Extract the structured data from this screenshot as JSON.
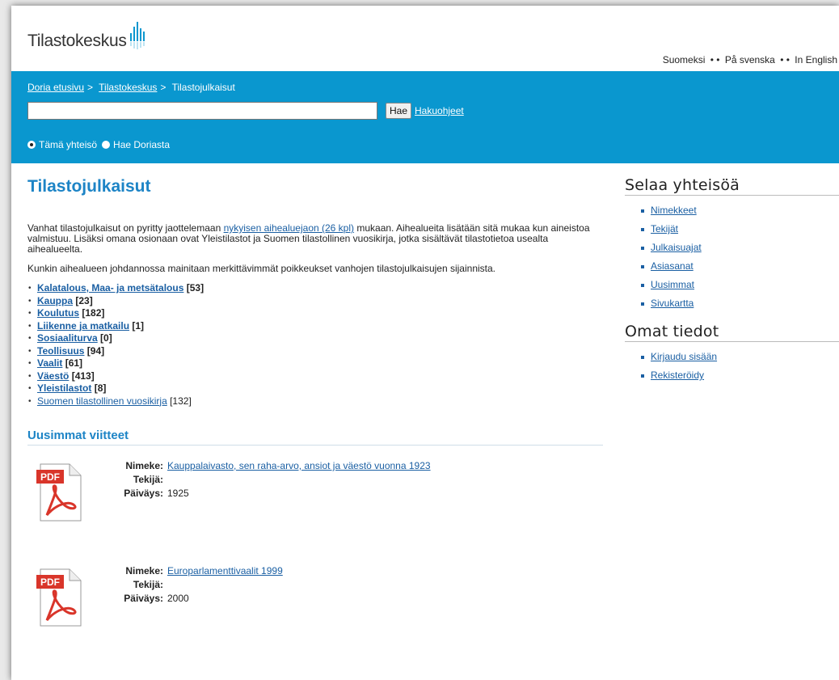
{
  "header": {
    "logo_text": "Tilastokeskus",
    "languages": [
      "Suomeksi",
      "På svenska",
      "In English"
    ],
    "separator": "• •"
  },
  "bluebar": {
    "breadcrumbs": [
      {
        "label": "Doria etusivu",
        "link": true
      },
      {
        "label": "Tilastokeskus",
        "link": true
      },
      {
        "label": "Tilastojulkaisut",
        "link": false
      }
    ],
    "breadcrumb_sep": ">",
    "search": {
      "value": "",
      "button_label": "Hae",
      "help_label": "Hakuohjeet"
    },
    "scope_options": [
      {
        "label": "Tämä yhteisö",
        "checked": true
      },
      {
        "label": "Hae Doriasta",
        "checked": false
      }
    ]
  },
  "main": {
    "title": "Tilastojulkaisut",
    "intro_before_link": "Vanhat tilastojulkaisut on pyritty jaottelemaan ",
    "intro_link": "nykyisen aihealuejaon (26 kpl)",
    "intro_after_link": " mukaan. Aihealueita lisätään sitä mukaa kun aineistoa valmistuu. Lisäksi omana osionaan ovat Yleistilastot ja Suomen tilastollinen vuosikirja, jotka sisältävät tilastotietoa usealta aihealueelta.",
    "paragraph2": "Kunkin aihealueen johdannossa mainitaan merkittävimmät poikkeukset vanhojen tilastojulkaisujen sijainnista.",
    "categories": [
      {
        "label": "Kalatalous, Maa- ja metsätalous",
        "count": "[53]",
        "bold": true
      },
      {
        "label": "Kauppa",
        "count": "[23]",
        "bold": true
      },
      {
        "label": "Koulutus",
        "count": "[182]",
        "bold": true
      },
      {
        "label": "Liikenne ja matkailu",
        "count": "[1]",
        "bold": true
      },
      {
        "label": "Sosiaaliturva",
        "count": "[0]",
        "bold": true
      },
      {
        "label": "Teollisuus",
        "count": "[94]",
        "bold": true
      },
      {
        "label": "Vaalit",
        "count": "[61]",
        "bold": true
      },
      {
        "label": "Väestö",
        "count": "[413]",
        "bold": true
      },
      {
        "label": "Yleistilastot",
        "count": "[8]",
        "bold": true
      },
      {
        "label": "Suomen tilastollinen vuosikirja",
        "count": "[132]",
        "bold": false
      }
    ],
    "recent_heading": "Uusimmat viitteet",
    "meta_labels": {
      "title": "Nimeke:",
      "author": "Tekijä:",
      "date": "Päiväys:"
    },
    "entries": [
      {
        "title": "Kauppalaivasto, sen raha-arvo, ansiot ja väestö vuonna 1923",
        "author": "",
        "date": "1925",
        "icon": "pdf-icon",
        "icon_label": "PDF"
      },
      {
        "title": "Europarlamenttivaalit 1999",
        "author": "",
        "date": "2000",
        "icon": "pdf-icon",
        "icon_label": "PDF"
      }
    ]
  },
  "sidebar": {
    "browse_heading": "Selaa yhteisöä",
    "browse_items": [
      "Nimekkeet",
      "Tekijät",
      "Julkaisuajat",
      "Asiasanat",
      "Uusimmat",
      "Sivukartta"
    ],
    "account_heading": "Omat tiedot",
    "account_items": [
      "Kirjaudu sisään",
      "Rekisteröidy"
    ]
  },
  "colors": {
    "bluebar": "#0a97cf",
    "title": "#1d84c6",
    "link": "#1a5fa3",
    "pdf_red": "#d9352a"
  }
}
